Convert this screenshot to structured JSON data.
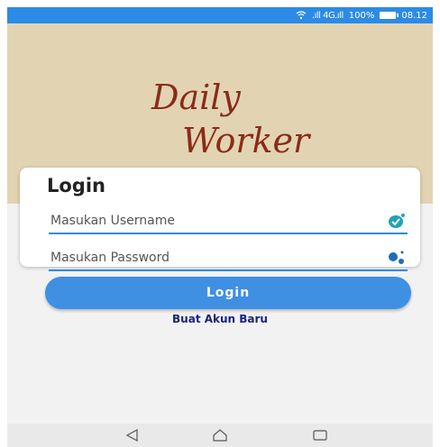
{
  "status_bar": {
    "signal_text": ".ıll 4G.ıll",
    "battery_percent": "100%",
    "time": "08.12",
    "icons": [
      "wifi-icon",
      "signal-icon",
      "battery-icon"
    ],
    "background_color": "#2b8be6"
  },
  "app": {
    "logo_line1": "Daily",
    "logo_line2": "Worker",
    "logo_color": "#8a2b18",
    "header_color": "#e2d4b3"
  },
  "login_card": {
    "title": "Login",
    "username": {
      "placeholder": "Masukan Username",
      "value": "",
      "icon": "check-badge-icon"
    },
    "password": {
      "placeholder": "Masukan Password",
      "value": "",
      "icon": "dots-icon"
    }
  },
  "actions": {
    "login_label": "Login",
    "register_label": "Buat Akun Baru",
    "accent_color": "#3f8fe3"
  },
  "nav_bar": {
    "icons": [
      "back-icon",
      "home-icon",
      "recents-icon"
    ]
  }
}
